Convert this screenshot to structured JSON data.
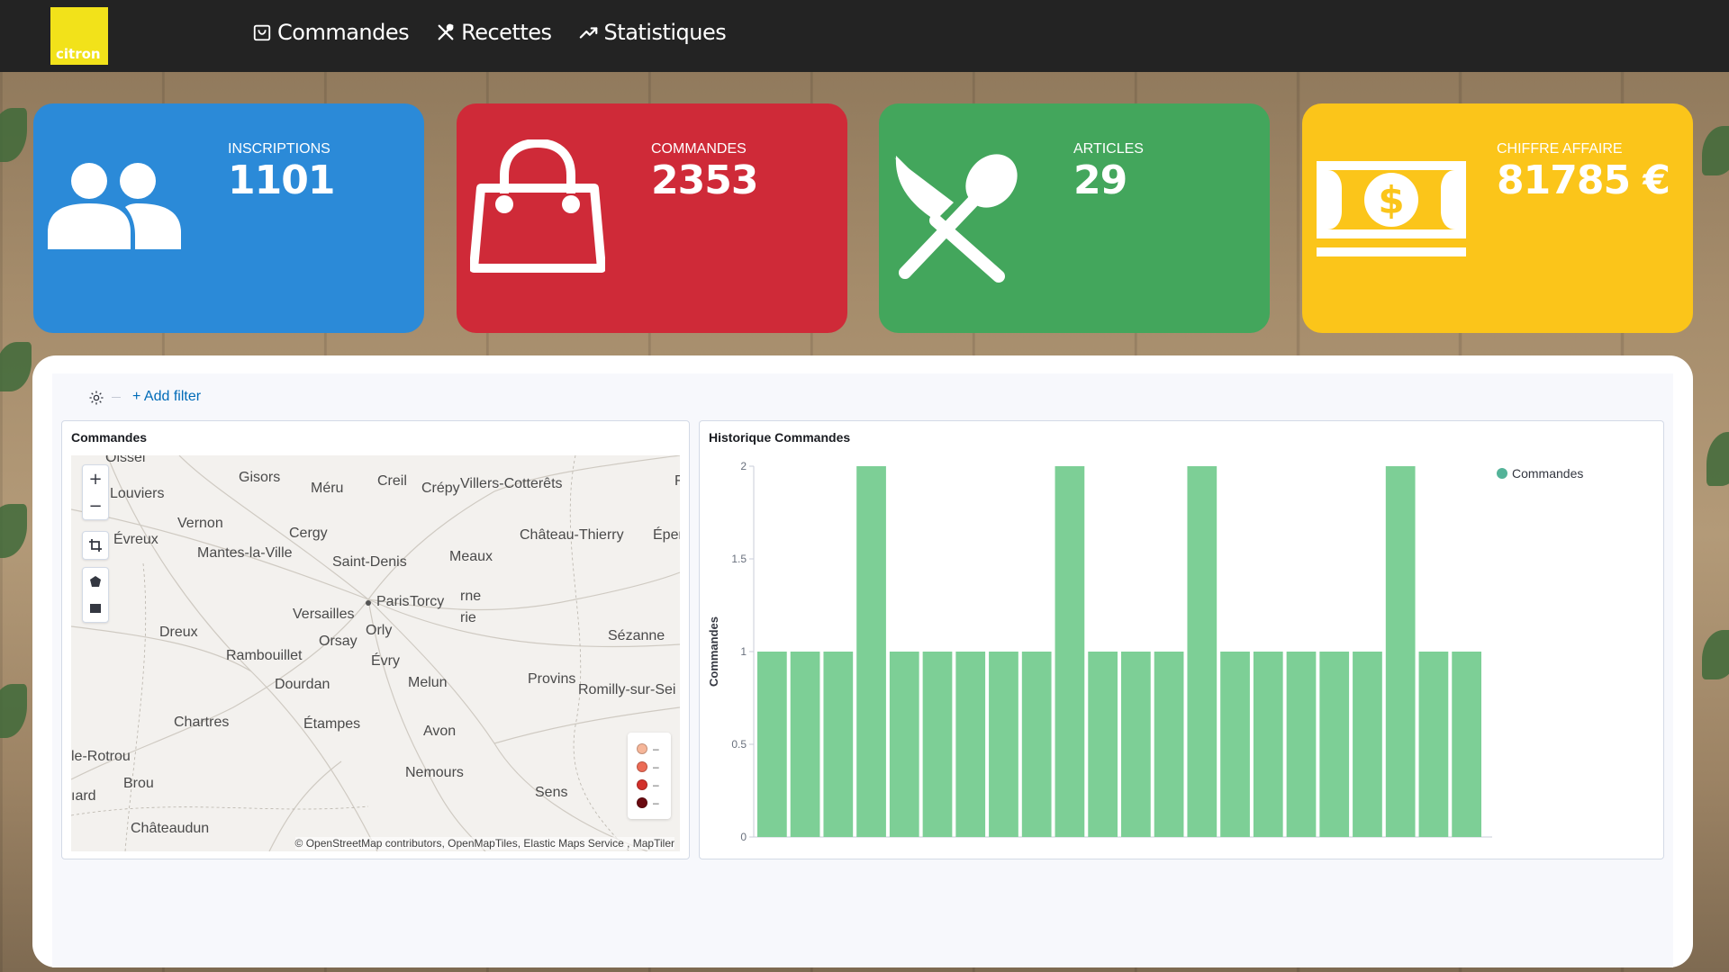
{
  "app": {
    "logo_text": "citron"
  },
  "nav": [
    {
      "label": "Commandes",
      "icon": "shopping-bag-icon"
    },
    {
      "label": "Recettes",
      "icon": "utensils-icon"
    },
    {
      "label": "Statistiques",
      "icon": "trend-icon"
    }
  ],
  "cards": [
    {
      "caption": "INSCRIPTIONS",
      "value": "1101",
      "color": "#2b8ad8",
      "icon": "users-icon"
    },
    {
      "caption": "COMMANDES",
      "value": "2353",
      "color": "#cf2a38",
      "icon": "shopping-bag-icon"
    },
    {
      "caption": "ARTICLES",
      "value": "29",
      "color": "#43a65c",
      "icon": "utensils-icon"
    },
    {
      "caption": "CHIFFRE AFFAIRE",
      "value": "81785 €",
      "color": "#fbc51a",
      "icon": "money-icon"
    }
  ],
  "filter": {
    "add_label": "+ Add filter"
  },
  "map_panel": {
    "title": "Commandes",
    "towns": [
      "Oissel",
      "Louviers",
      "Gisors",
      "Méru",
      "Creil",
      "Crépy",
      "Villers-Cotterêts",
      "Évreux",
      "Vernon",
      "Cergy",
      "Château-Thierry",
      "Éper",
      "Mantes-la-Ville",
      "Saint-Denis",
      "Meaux",
      "Paris",
      "Torcy",
      "rne",
      "Versailles",
      "rie",
      "Orly",
      "Dreux",
      "Orsay",
      "Sézanne",
      "Rambouillet",
      "Évry",
      "Melun",
      "Provins",
      "Dourdan",
      "Romilly-sur-Sei",
      "Chartres",
      "Étampes",
      "Avon",
      "le-Rotrou",
      "Nemours",
      "Brou",
      "Sens",
      "ıard",
      "Châteaudun",
      "F"
    ],
    "legend": [
      {
        "label": "–",
        "color": "#f6b699"
      },
      {
        "label": "–",
        "color": "#ec6b56"
      },
      {
        "label": "–",
        "color": "#d2302b"
      },
      {
        "label": "–",
        "color": "#6a0a10"
      }
    ],
    "attribution": "© OpenStreetMap contributors, OpenMapTiles, Elastic Maps Service , MapTiler",
    "controls": {
      "zoom_in": "+",
      "zoom_out": "−"
    }
  },
  "bar_panel": {
    "title": "Historique Commandes"
  },
  "chart_data": {
    "type": "bar",
    "title": "Historique Commandes",
    "ylabel": "Commandes",
    "xlabel": "",
    "ylim": [
      0,
      2
    ],
    "yticks": [
      0,
      0.5,
      1,
      1.5,
      2
    ],
    "legend_position": "top-right",
    "grid": false,
    "series": [
      {
        "name": "Commandes",
        "color": "#7dcf96",
        "values": [
          1,
          1,
          1,
          2,
          1,
          1,
          1,
          1,
          1,
          2,
          1,
          1,
          1,
          2,
          1,
          1,
          1,
          1,
          1,
          2,
          1,
          1
        ]
      }
    ]
  }
}
